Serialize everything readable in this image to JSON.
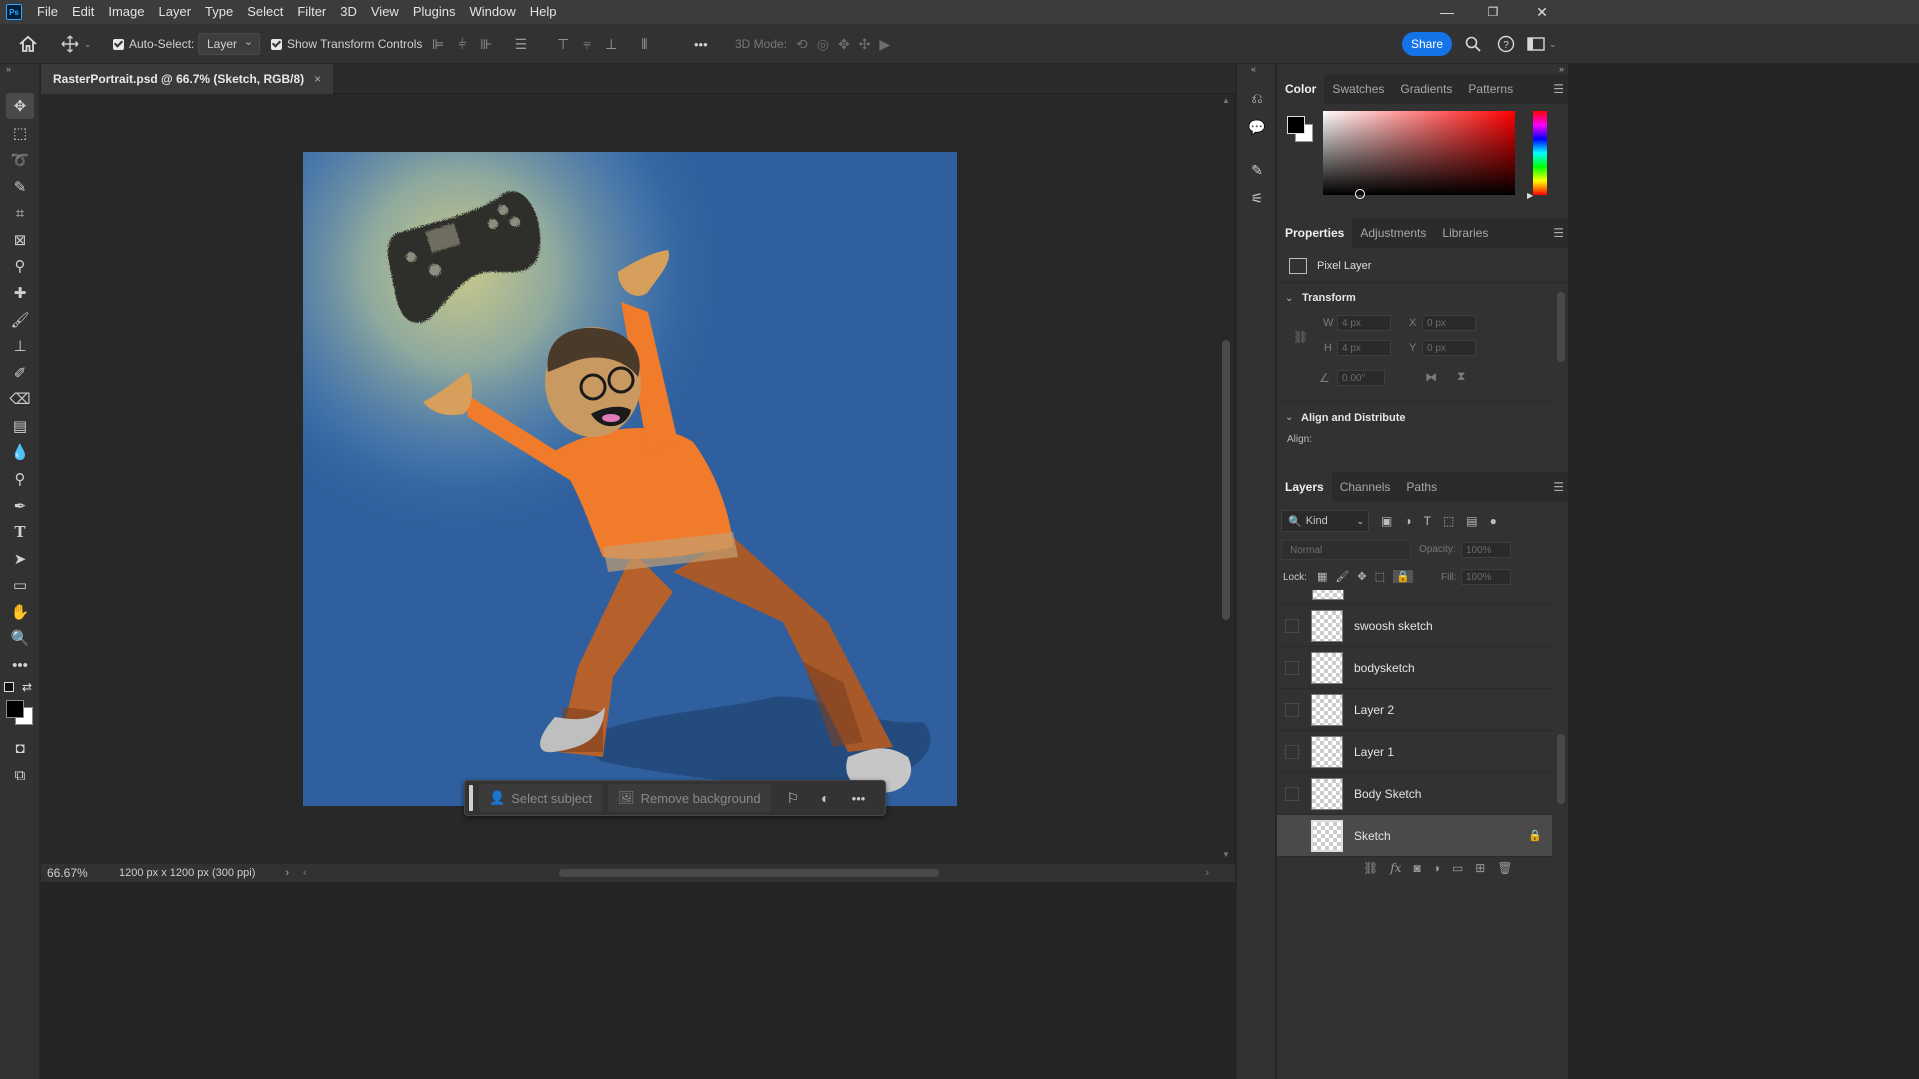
{
  "app": {
    "logo": "Ps"
  },
  "menu": [
    "File",
    "Edit",
    "Image",
    "Layer",
    "Type",
    "Select",
    "Filter",
    "3D",
    "View",
    "Plugins",
    "Window",
    "Help"
  ],
  "window_controls": {
    "minimize": "—",
    "restore": "❐",
    "close": "✕"
  },
  "options": {
    "auto_select_label": "Auto-Select:",
    "auto_select_target": "Layer",
    "show_transform_label": "Show Transform Controls",
    "three_d_mode_label": "3D Mode:",
    "share_label": "Share",
    "more": "•••"
  },
  "document": {
    "tab_title": "RasterPortrait.psd @ 66.7% (Sketch, RGB/8)",
    "close": "×"
  },
  "status": {
    "zoom": "66.67%",
    "doc_info": "1200 px x 1200 px (300 ppi)",
    "arrow": "›"
  },
  "taskbar": {
    "select_subject": "Select subject",
    "remove_background": "Remove background",
    "more": "•••"
  },
  "color_panel": {
    "tabs": [
      "Color",
      "Swatches",
      "Gradients",
      "Patterns"
    ],
    "active_tab": "Color"
  },
  "properties_panel": {
    "tabs": [
      "Properties",
      "Adjustments",
      "Libraries"
    ],
    "layer_type": "Pixel Layer",
    "transform_label": "Transform",
    "w_label": "W",
    "w_value": "4 px",
    "h_label": "H",
    "h_value": "4 px",
    "x_label": "X",
    "x_value": "0 px",
    "y_label": "Y",
    "y_value": "0 px",
    "angle_value": "0.00°",
    "align_label": "Align and Distribute",
    "align_sub": "Align:"
  },
  "layers_panel": {
    "tabs": [
      "Layers",
      "Channels",
      "Paths"
    ],
    "filter_kind": "Kind",
    "blend_mode": "Normal",
    "opacity_label": "Opacity:",
    "opacity_value": "100%",
    "lock_label": "Lock:",
    "fill_label": "Fill:",
    "fill_value": "100%",
    "layers": [
      {
        "name": "swoosh sketch",
        "selected": false
      },
      {
        "name": "bodysketch",
        "selected": false
      },
      {
        "name": "Layer 2",
        "selected": false
      },
      {
        "name": "Layer 1",
        "selected": false
      },
      {
        "name": "Body Sketch",
        "selected": false
      },
      {
        "name": "Sketch",
        "selected": true,
        "locked": true
      }
    ]
  },
  "colors": {
    "accent": "#1473e6",
    "canvas_bg": "#2f5f9e",
    "sweater": "#f07b2a",
    "pants": "#b6602c"
  }
}
